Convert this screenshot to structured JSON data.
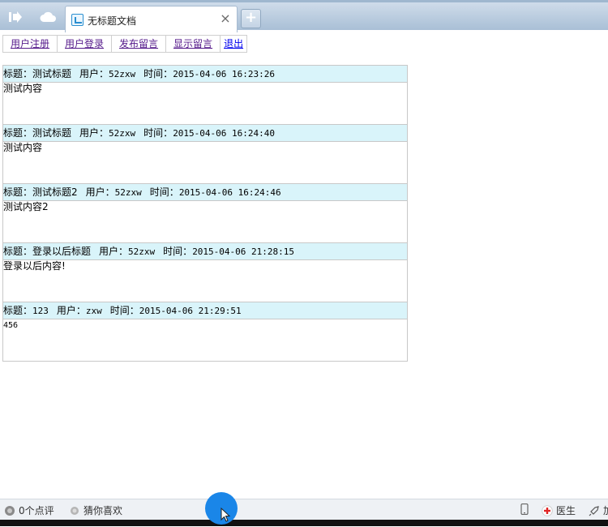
{
  "browser": {
    "tab_title": "无标题文档",
    "tab_close": "×",
    "new_tab": "+"
  },
  "nav": [
    {
      "label": "用户注册"
    },
    {
      "label": "用户登录"
    },
    {
      "label": "发布留言"
    },
    {
      "label": "显示留言"
    },
    {
      "label": "退出"
    }
  ],
  "labels": {
    "title": "标题：",
    "user": "用户：",
    "time": "时间："
  },
  "messages": [
    {
      "title": "测试标题",
      "user": "52zxw",
      "time": "2015-04-06 16:23:26",
      "content": "测试内容"
    },
    {
      "title": "测试标题",
      "user": "52zxw",
      "time": "2015-04-06 16:24:40",
      "content": "测试内容"
    },
    {
      "title": "测试标题2",
      "user": "52zxw",
      "time": "2015-04-06 16:24:46",
      "content": "测试内容2"
    },
    {
      "title": "登录以后标题",
      "user": "52zxw",
      "time": "2015-04-06 21:28:15",
      "content": "登录以后内容!"
    },
    {
      "title": "123",
      "user": "zxw",
      "time": "2015-04-06 21:29:51",
      "content": "456"
    }
  ],
  "statusbar": {
    "comments": "0个点评",
    "recommend": "猜你喜欢",
    "doctor": "医生",
    "accel": "加"
  },
  "icons": {
    "back": "exit-arrow-icon",
    "cloud": "cloud-icon",
    "favicon": "page-favicon-icon"
  }
}
